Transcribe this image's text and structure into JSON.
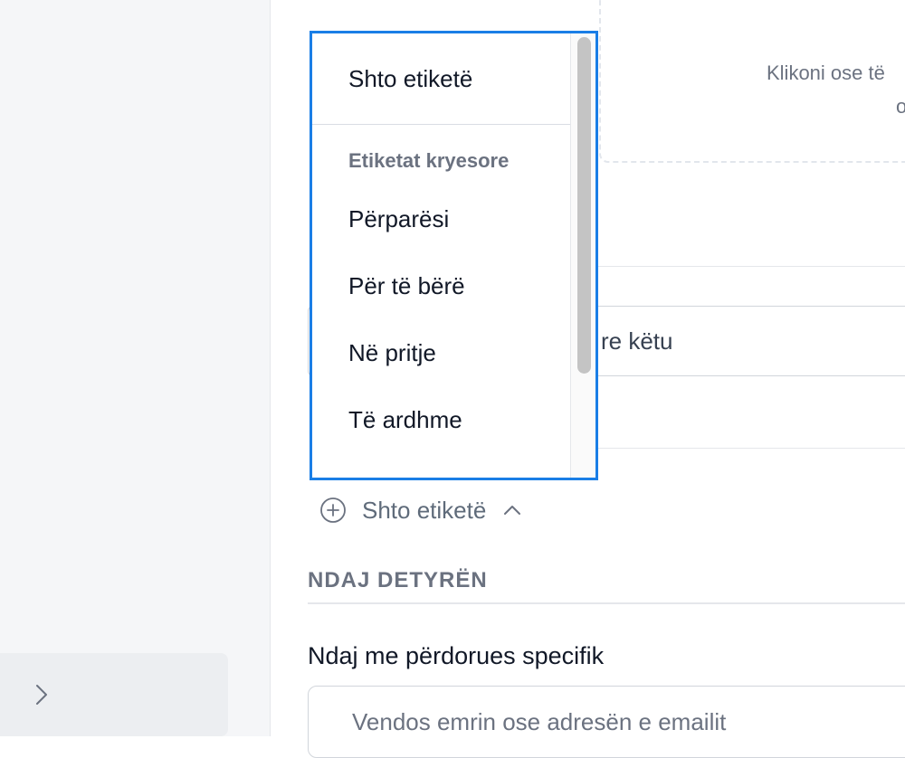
{
  "upload": {
    "line1": "Klikoni ose të",
    "line2": "o"
  },
  "note": {
    "placeholder_visible": "re këtu"
  },
  "labels": {
    "add_button_label": "Shto etiketë",
    "dropdown": {
      "add_option": "Shto etiketë",
      "group_header": "Etiketat kryesore",
      "items": [
        "Përparësi",
        "Për të bërë",
        "Në pritje",
        "Të ardhme"
      ]
    }
  },
  "share": {
    "section_title": "NDAJ DETYRËN",
    "field_label": "Ndaj me përdorues specifik",
    "input_placeholder": "Vendos emrin ose adresën e emailit"
  },
  "icons": {
    "sidebar_expand": "chevron-right-icon",
    "add_label": "plus-circle-icon",
    "dropdown_toggle": "chevron-up-icon"
  },
  "colors": {
    "focus_border": "#1a7ee6",
    "muted_text": "#6b7280"
  }
}
